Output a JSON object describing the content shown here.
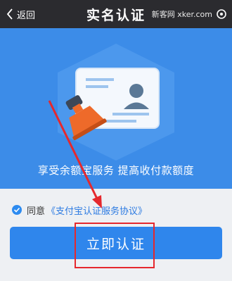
{
  "navbar": {
    "back_label": "返回",
    "title": "实名认证",
    "watermark": "新客网 xker.com"
  },
  "hero": {
    "description": "享受余额宝服务 提高收付款额度"
  },
  "agreement": {
    "prefix": "同意",
    "link_text": "《支付宝认证服务协议》"
  },
  "submit": {
    "label": "立即认证"
  },
  "colors": {
    "navbar_bg": "#2b2b2f",
    "hero_bg": "#3c8ce8",
    "button_bg": "#2f86ec",
    "link": "#2d7be2",
    "annotation_red": "#e5282d"
  }
}
